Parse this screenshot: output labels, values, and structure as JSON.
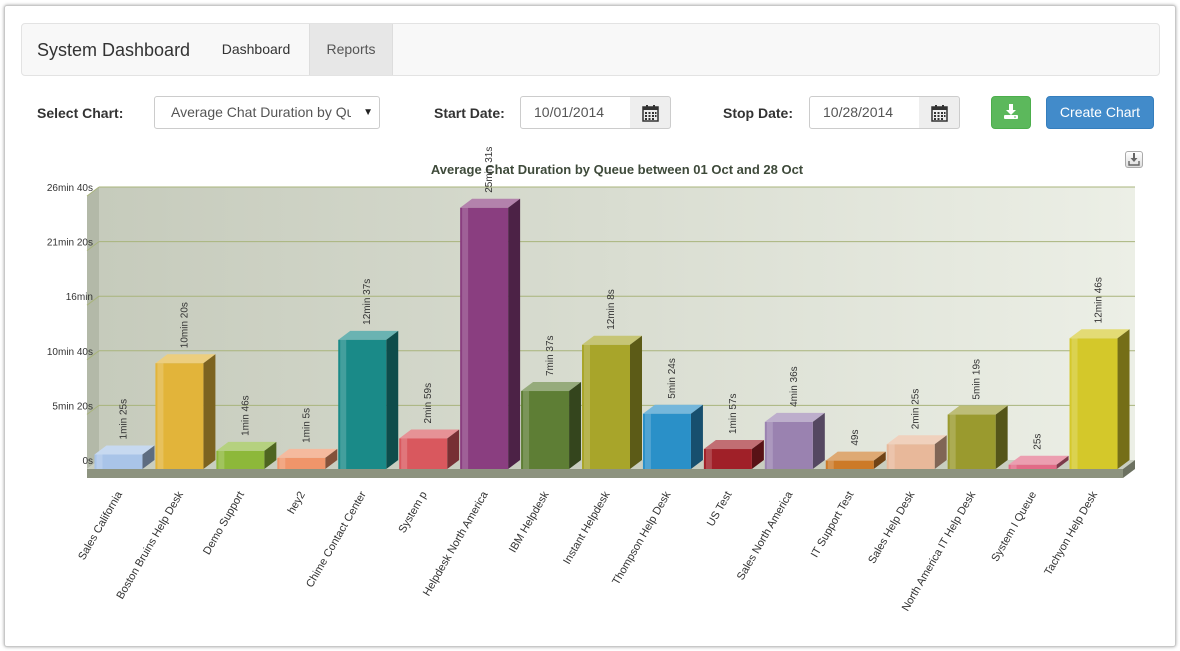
{
  "navbar": {
    "brand": "System Dashboard",
    "links": [
      {
        "label": "Dashboard",
        "active": false
      },
      {
        "label": "Reports",
        "active": true
      }
    ]
  },
  "controls": {
    "select_chart_label": "Select Chart:",
    "select_chart_value": "Average Chat Duration by Queue",
    "start_date_label": "Start Date:",
    "start_date_value": "10/01/2014",
    "stop_date_label": "Stop Date:",
    "stop_date_value": "10/28/2014",
    "download_icon": "download-icon",
    "calendar_icon": "calendar-icon",
    "create_chart_label": "Create Chart"
  },
  "colors": {
    "download_button": "#5cb85c",
    "create_button": "#428bca"
  },
  "chart_data": {
    "type": "bar",
    "title": "Average Chat Duration by Queue between 01 Oct and 28 Oct",
    "y_ticks": [
      "0s",
      "5min 20s",
      "10min 40s",
      "16min",
      "21min 20s",
      "26min 40s"
    ],
    "ylim_seconds": [
      0,
      1600
    ],
    "grid": true,
    "categories": [
      "Sales California",
      "Boston Bruins Help Desk",
      "Demo Support",
      "hey2",
      "Chime Contact Center",
      "System p",
      "Helpdesk North America",
      "IBM Helpdesk",
      "Instant Helpdesk",
      "Thompson Help Desk",
      "US Test",
      "Sales North America",
      "IT Support Test",
      "Sales Help Desk",
      "North America IT Help Desk",
      "System I Queue",
      "Tachyon Help Desk"
    ],
    "labels": [
      "1min 25s",
      "10min 20s",
      "1min 46s",
      "1min 5s",
      "12min 37s",
      "2min 59s",
      "25min 31s",
      "7min 37s",
      "12min 8s",
      "5min 24s",
      "1min 57s",
      "4min 36s",
      "49s",
      "2min 25s",
      "5min 19s",
      "25s",
      "12min 46s"
    ],
    "values_seconds": [
      85,
      620,
      106,
      65,
      757,
      179,
      1531,
      457,
      728,
      324,
      117,
      276,
      49,
      145,
      319,
      25,
      766
    ],
    "colors": [
      "#a9c4e8",
      "#e2b43a",
      "#8db83a",
      "#f0956a",
      "#1a8a88",
      "#d9585e",
      "#8a3e80",
      "#5e7e35",
      "#a8a52a",
      "#2a90c8",
      "#a02028",
      "#9a82b0",
      "#cc7a28",
      "#e8b89a",
      "#9a9a2e",
      "#e26a86",
      "#d4c82a"
    ]
  }
}
